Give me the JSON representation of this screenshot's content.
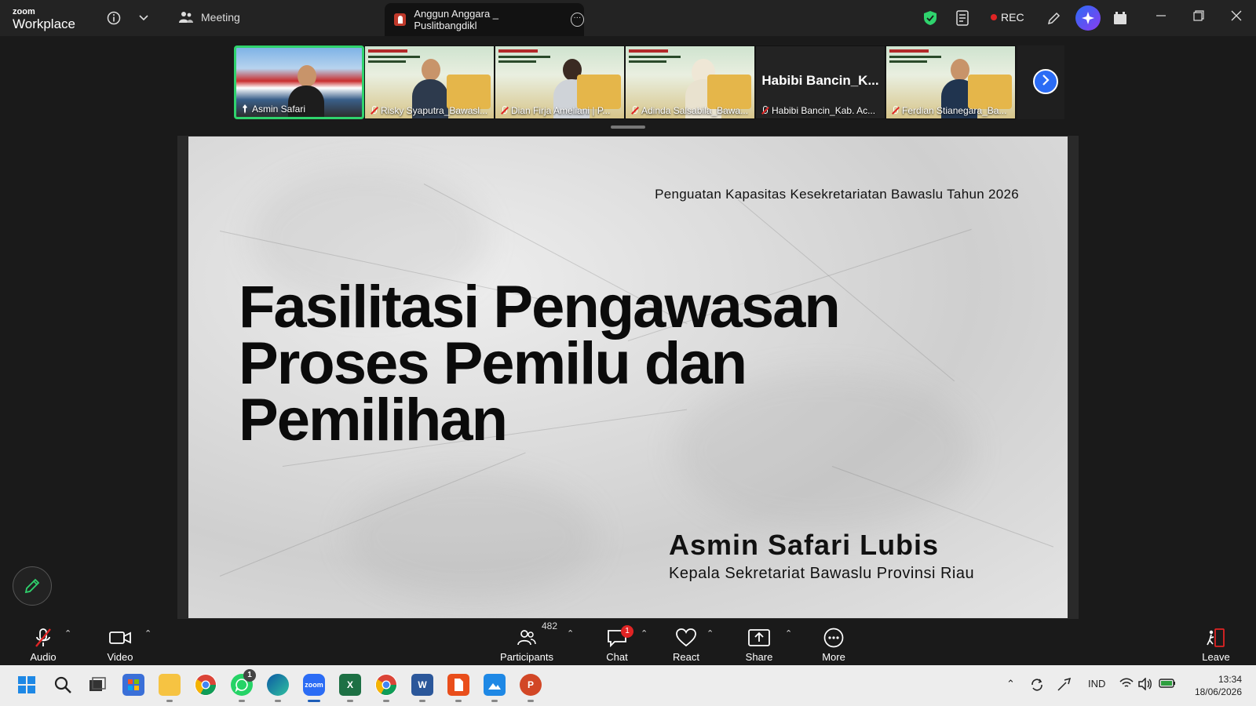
{
  "app": {
    "brand_top": "zoom",
    "brand_bottom": "Workplace",
    "meeting_label": "Meeting",
    "share_tab_label": "Anggun Anggara _ Puslitbangdikl",
    "rec_label": "REC"
  },
  "participants_strip": [
    {
      "name": "Asmin Safari",
      "active": true
    },
    {
      "name": "Risky Syaputra_Bawasl..."
    },
    {
      "name": "Dian Firja Ameliani | P..."
    },
    {
      "name": "Adinda Salsabila_Bawa..."
    },
    {
      "name": "Habibi Bancin_Kab. Ac...",
      "big_label": "Habibi  Bancin_K..."
    },
    {
      "name": "Ferdian Stianegara_Ba..."
    }
  ],
  "slide": {
    "top_text": "Penguatan Kapasitas Kesekretariatan Bawaslu Tahun 2026",
    "title": "Fasilitasi Pengawasan Proses Pemilu dan Pemilihan",
    "author": "Asmin Safari Lubis",
    "role": "Kepala Sekretariat Bawaslu Provinsi Riau"
  },
  "toolbar": {
    "audio": "Audio",
    "video": "Video",
    "participants": "Participants",
    "participants_count": "482",
    "chat": "Chat",
    "chat_badge": "1",
    "react": "React",
    "share": "Share",
    "more": "More",
    "leave": "Leave"
  },
  "taskbar": {
    "whatsapp_badge": "1",
    "language": "IND",
    "time": "13:34",
    "date": "18/06/2026"
  },
  "colors": {
    "active_border": "#2fd36d",
    "accent_blue": "#2b6cf5",
    "rec_red": "#e02424"
  }
}
